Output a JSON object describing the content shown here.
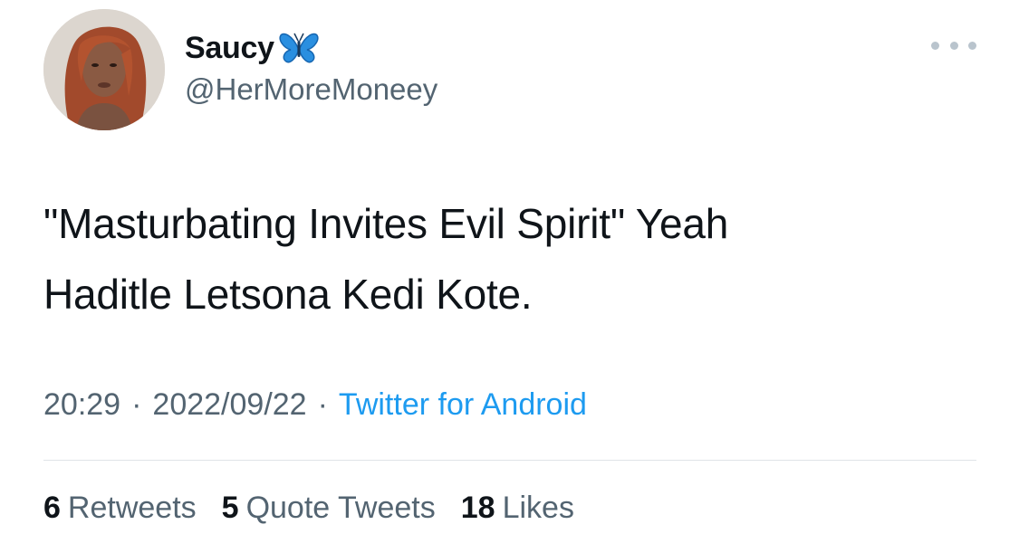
{
  "user": {
    "display_name": "Saucy",
    "handle": "@HerMoreMoneey",
    "emoji_icon": "butterfly-icon"
  },
  "tweet": {
    "text_line1": "\"Masturbating Invites Evil Spirit\" Yeah",
    "text_line2": "Haditle Letsona Kedi Kote."
  },
  "meta": {
    "time": "20:29",
    "separator": "·",
    "date": "2022/09/22",
    "source": "Twitter for Android"
  },
  "stats": {
    "retweets_count": "6",
    "retweets_label": "Retweets",
    "quotes_count": "5",
    "quotes_label": "Quote Tweets",
    "likes_count": "18",
    "likes_label": "Likes"
  },
  "colors": {
    "text_primary": "#0f1419",
    "text_secondary": "#536471",
    "link": "#1d9bf0",
    "divider": "#dfe4e8"
  }
}
